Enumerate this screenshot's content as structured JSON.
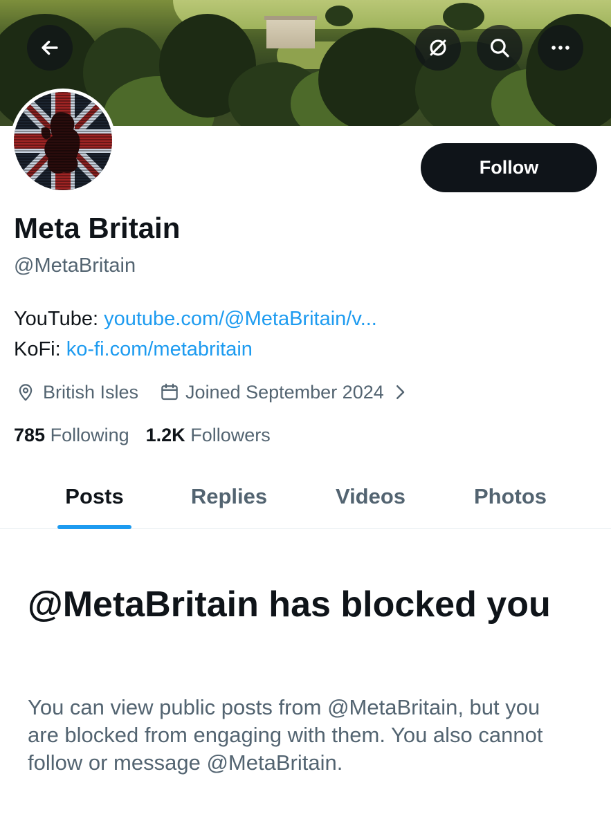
{
  "banner": {
    "back_icon": "arrow-left-icon",
    "actions": [
      {
        "name": "link-broken-icon"
      },
      {
        "name": "search-icon"
      },
      {
        "name": "more-icon"
      }
    ]
  },
  "profile": {
    "name": "Meta Britain",
    "handle": "@MetaBritain",
    "follow_label": "Follow",
    "bio": {
      "youtube_label": "YouTube: ",
      "youtube_link": "youtube.com/@MetaBritain/v...",
      "kofi_label": "KoFi: ",
      "kofi_link": "ko-fi.com/metabritain"
    },
    "location": "British Isles",
    "joined": "Joined September 2024",
    "following_count": "785",
    "following_label": "Following",
    "followers_count": "1.2K",
    "followers_label": "Followers"
  },
  "tabs": [
    {
      "label": "Posts",
      "active": true
    },
    {
      "label": "Replies",
      "active": false
    },
    {
      "label": "Videos",
      "active": false
    },
    {
      "label": "Photos",
      "active": false
    }
  ],
  "blocked": {
    "title": "@MetaBritain has blocked you",
    "description": "You can view public posts from @MetaBritain, but you are blocked from engaging with them. You also cannot follow or message @MetaBritain."
  },
  "colors": {
    "accent": "#1d9bf0",
    "text_primary": "#0f1419",
    "text_secondary": "#536471"
  }
}
